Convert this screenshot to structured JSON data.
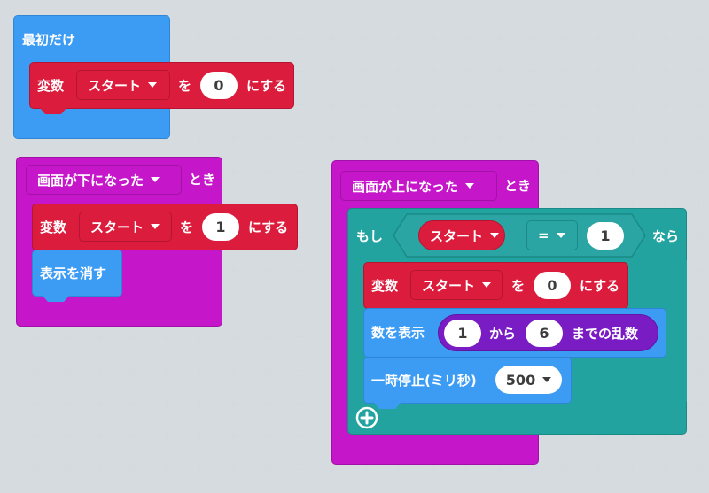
{
  "workspace": {
    "background": "#eceff1"
  },
  "colors": {
    "basic_blue": "#3c9cf4",
    "event_magenta": "#c616ca",
    "variable_red": "#dc1c3c",
    "logic_teal": "#22a39f",
    "math_purple": "#7a1cc4",
    "compare_teal": "#2ba5a3"
  },
  "on_start": {
    "label": "最初だけ",
    "set_var": {
      "label_left": "変数",
      "variable": "スタート",
      "label_to": "を",
      "value": "0",
      "label_right": "にする"
    }
  },
  "gesture_down": {
    "event_dropdown": "画面が下になった",
    "label_when": "とき",
    "set_var": {
      "label_left": "変数",
      "variable": "スタート",
      "label_to": "を",
      "value": "1",
      "label_right": "にする"
    },
    "clear_screen": "表示を消す"
  },
  "gesture_up": {
    "event_dropdown": "画面が上になった",
    "label_when": "とき",
    "if_block": {
      "label_if": "もし",
      "compare_left": "スタート",
      "operator": "=",
      "compare_right": "1",
      "label_then": "なら"
    },
    "set_var": {
      "label_left": "変数",
      "variable": "スタート",
      "label_to": "を",
      "value": "0",
      "label_right": "にする"
    },
    "show_number": {
      "label": "数を表示",
      "random_from": "1",
      "label_from": "から",
      "random_to": "6",
      "label_until": "までの乱数"
    },
    "pause": {
      "label": "一時停止(ミリ秒)",
      "value": "500"
    },
    "add_icon": "plus-circle-icon"
  }
}
